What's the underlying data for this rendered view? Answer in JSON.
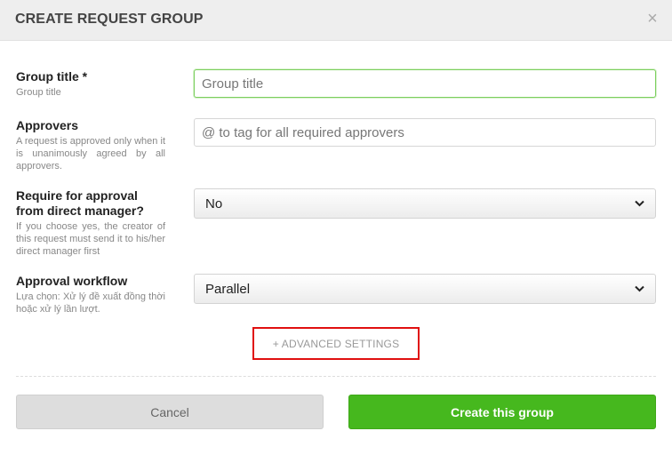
{
  "modal": {
    "title": "CREATE REQUEST GROUP",
    "close_symbol": "×"
  },
  "fields": {
    "group_title": {
      "label": "Group title *",
      "help": "Group title",
      "placeholder": "Group title",
      "value": ""
    },
    "approvers": {
      "label": "Approvers",
      "help": "A request is approved only when it is unanimously agreed by all approvers.",
      "placeholder": "@ to tag for all required approvers",
      "value": ""
    },
    "direct_manager": {
      "label": "Require for approval from direct manager?",
      "help": "If you choose yes, the creator of this request must send it to his/her direct manager first",
      "selected": "No"
    },
    "workflow": {
      "label": "Approval workflow",
      "help": "Lựa chọn: Xử lý đề xuất đồng thời hoặc xử lý lần lượt.",
      "selected": "Parallel"
    }
  },
  "advanced_settings_label": "+ ADVANCED SETTINGS",
  "buttons": {
    "cancel": "Cancel",
    "create": "Create this group"
  },
  "colors": {
    "primary": "#46b81e",
    "focus_border": "#7ccf5e",
    "highlight_border": "#e01010"
  }
}
